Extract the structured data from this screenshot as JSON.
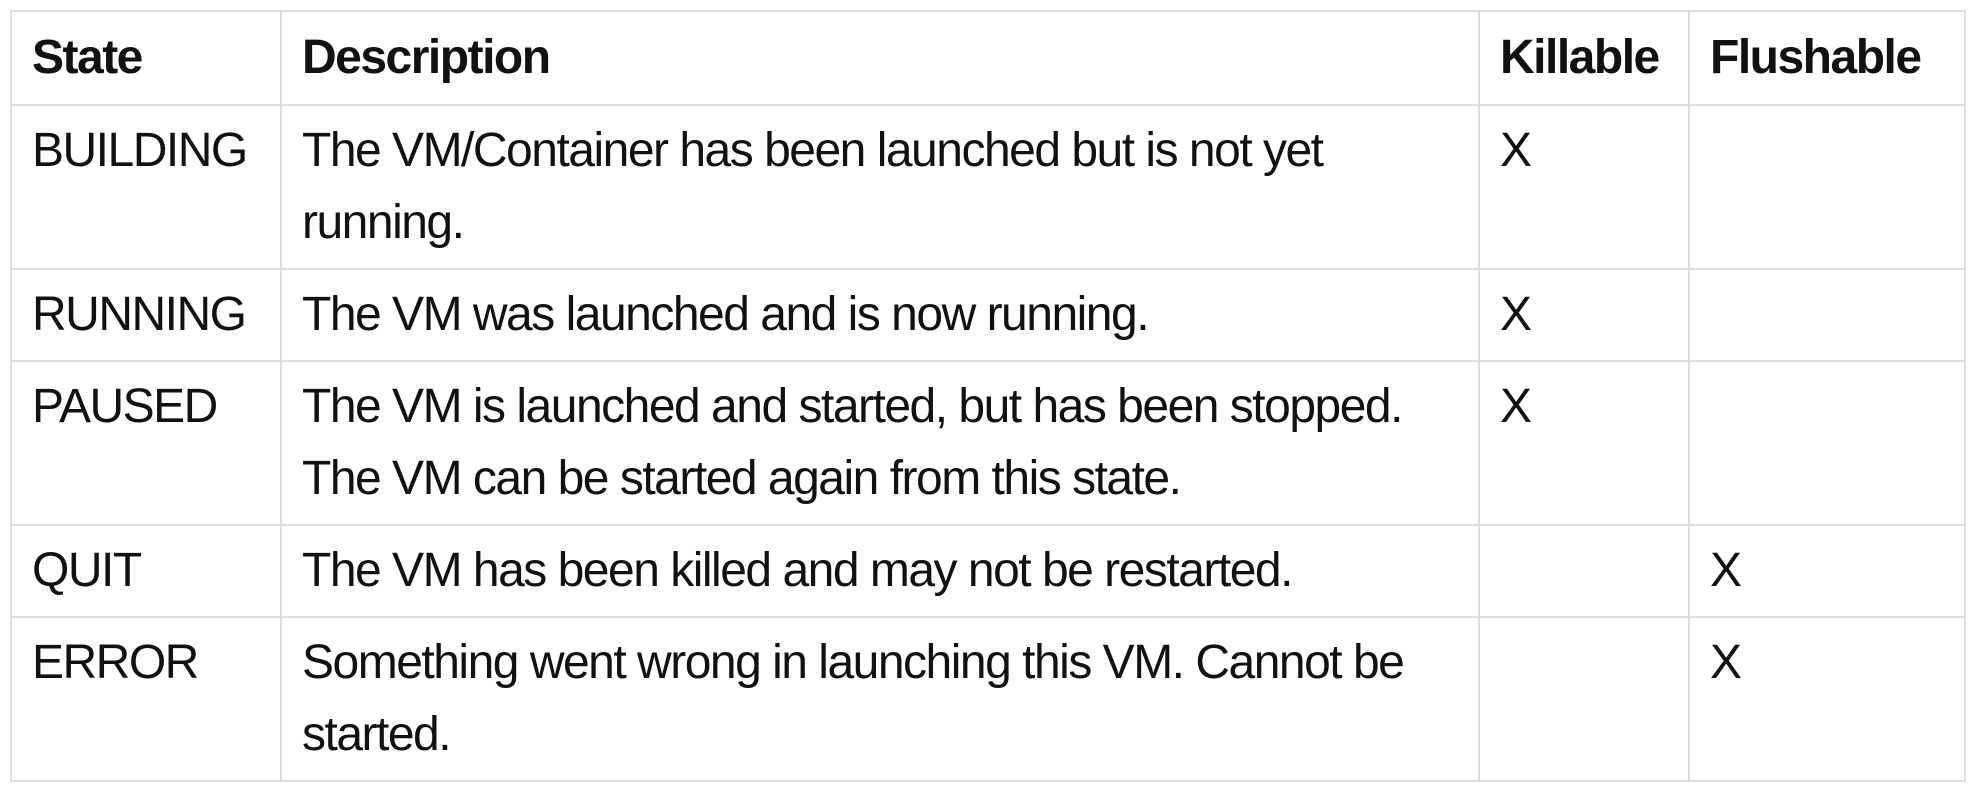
{
  "table": {
    "headers": {
      "state": "State",
      "description": "Description",
      "killable": "Killable",
      "flushable": "Flushable"
    },
    "rows": [
      {
        "state": "BUILDING",
        "description": "The VM/Container has been launched but is not yet running.",
        "killable": "X",
        "flushable": ""
      },
      {
        "state": "RUNNING",
        "description": "The VM was launched and is now running.",
        "killable": "X",
        "flushable": ""
      },
      {
        "state": "PAUSED",
        "description": "The VM is launched and started, but has been stopped. The VM can be started again from this state.",
        "killable": "X",
        "flushable": ""
      },
      {
        "state": "QUIT",
        "description": "The VM has been killed and may not be restarted.",
        "killable": "",
        "flushable": "X"
      },
      {
        "state": "ERROR",
        "description": "Something went wrong in launching this VM. Cannot be started.",
        "killable": "",
        "flushable": "X"
      }
    ]
  }
}
